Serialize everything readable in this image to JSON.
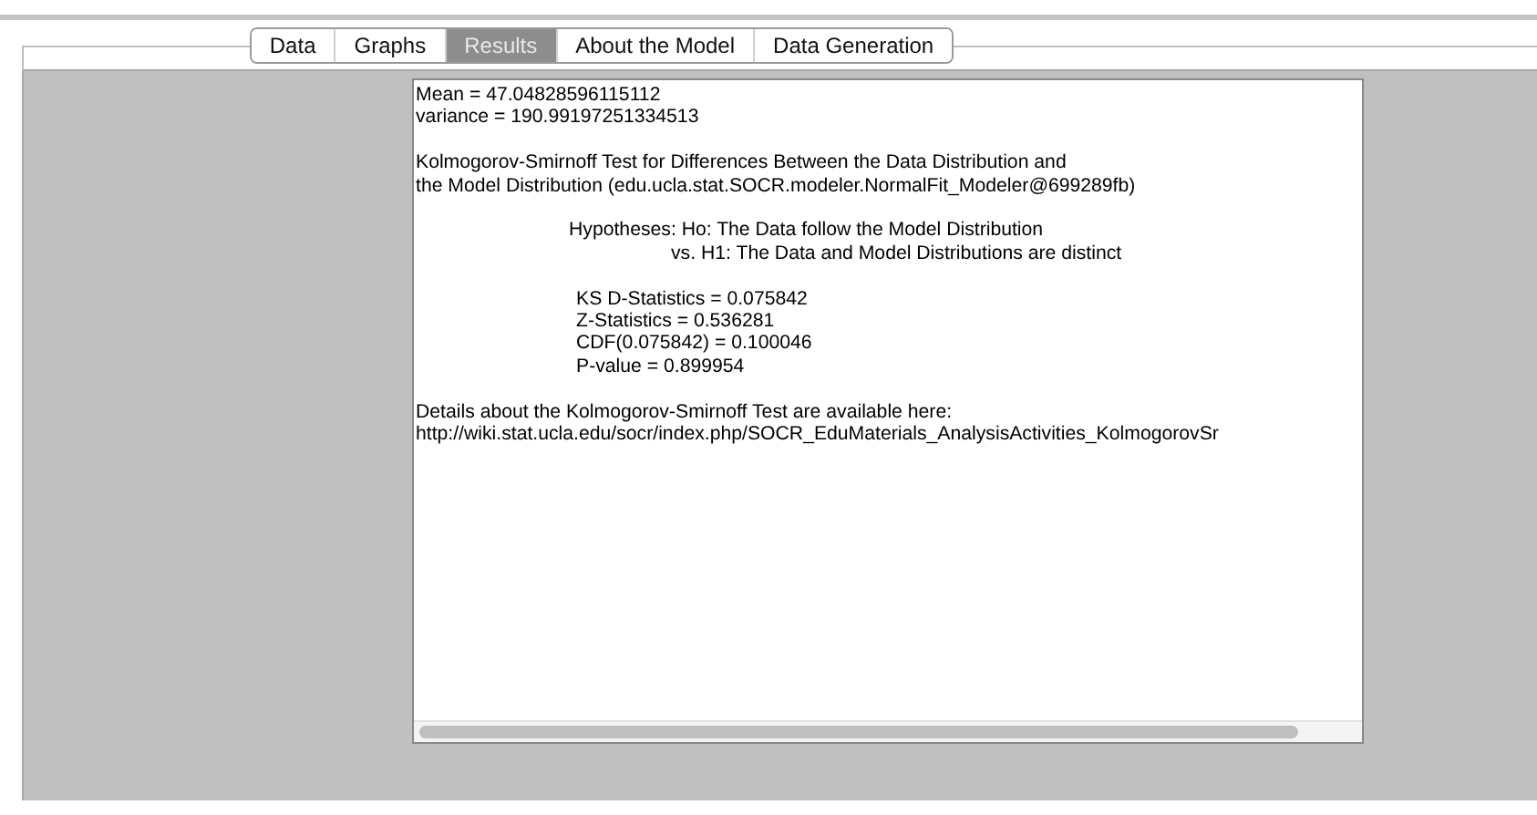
{
  "tabs": [
    {
      "label": "Data",
      "selected": false
    },
    {
      "label": "Graphs",
      "selected": false
    },
    {
      "label": "Results",
      "selected": true
    },
    {
      "label": "About the Model",
      "selected": false
    },
    {
      "label": "Data Generation",
      "selected": false
    }
  ],
  "results": {
    "blocks": [
      {
        "lines": [
          {
            "kind": "plain",
            "text": "Mean = 47.04828596115112"
          },
          {
            "kind": "plain",
            "text": "variance = 190.99197251334513"
          }
        ]
      },
      {
        "lines": [
          {
            "kind": "plain",
            "text": "Kolmogorov-Smirnoff Test for Differences Between the Data Distribution and"
          },
          {
            "kind": "plain",
            "text": "the Model Distribution (edu.ucla.stat.SOCR.modeler.NormalFit_Modeler@699289fb)"
          }
        ]
      },
      {
        "lines": [
          {
            "kind": "hypothesis",
            "text": "Hypotheses: Ho: The Data follow the Model Distribution"
          },
          {
            "kind": "alternative",
            "text": "vs. H1: The Data and Model Distributions are distinct"
          }
        ]
      },
      {
        "lines": [
          {
            "kind": "statistic",
            "text": "KS D-Statistics = 0.075842"
          },
          {
            "kind": "statistic",
            "text": "Z-Statistics = 0.536281"
          },
          {
            "kind": "statistic",
            "text": "CDF(0.075842) = 0.100046"
          },
          {
            "kind": "statistic",
            "text": "P-value = 0.899954"
          }
        ]
      },
      {
        "lines": [
          {
            "kind": "plain",
            "text": "Details about the Kolmogorov-Smirnoff Test are available here:"
          },
          {
            "kind": "plain",
            "text": "http://wiki.stat.ucla.edu/socr/index.php/SOCR_EduMaterials_AnalysisActivities_KolmogorovSr"
          }
        ]
      }
    ]
  }
}
